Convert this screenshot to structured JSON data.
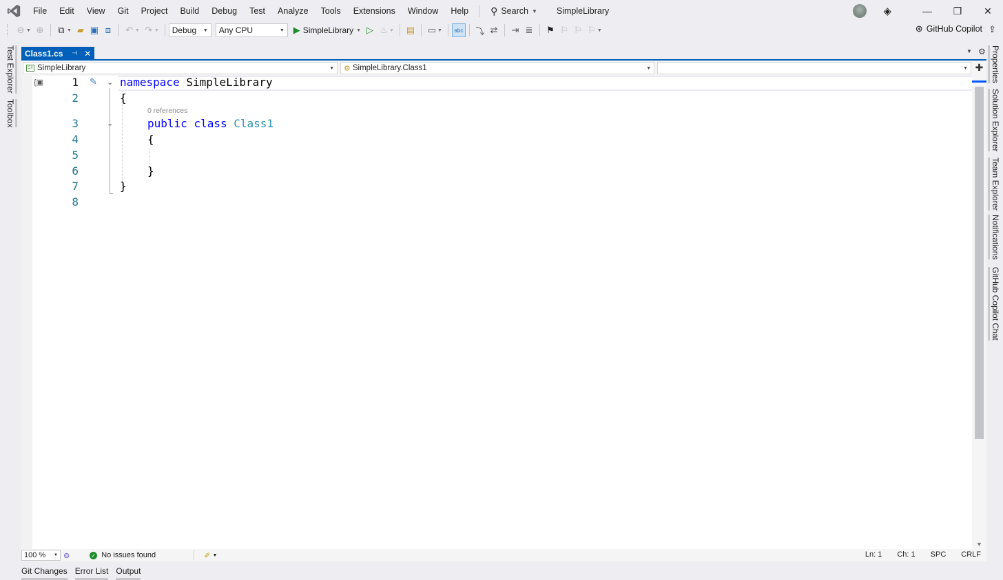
{
  "menubar": {
    "items": [
      "File",
      "Edit",
      "View",
      "Git",
      "Project",
      "Build",
      "Debug",
      "Test",
      "Analyze",
      "Tools",
      "Extensions",
      "Window",
      "Help"
    ],
    "search_label": "Search",
    "solution_name": "SimpleLibrary"
  },
  "toolbar": {
    "configuration": "Debug",
    "platform": "Any CPU",
    "startup_project": "SimpleLibrary",
    "copilot_label": "GitHub Copilot"
  },
  "left_tabs": [
    "Test Explorer",
    "Toolbox"
  ],
  "right_tabs": [
    "Properties",
    "Solution Explorer",
    "Team Explorer",
    "Notifications",
    "GitHub Copilot Chat"
  ],
  "document": {
    "tab_title": "Class1.cs"
  },
  "navbar": {
    "project": "SimpleLibrary",
    "type": "SimpleLibrary.Class1",
    "member": ""
  },
  "editor": {
    "line_numbers": [
      "1",
      "2",
      "3",
      "4",
      "5",
      "6",
      "7",
      "8"
    ],
    "codelens": "0 references",
    "lines": {
      "l1_kw": "namespace",
      "l1_name": "SimpleLibrary",
      "l2": "{",
      "l3_kw1": "public",
      "l3_kw2": "class",
      "l3_type": "Class1",
      "l4": "{",
      "l6": "}",
      "l7": "}"
    }
  },
  "status": {
    "zoom": "100 %",
    "issues": "No issues found",
    "line": "Ln: 1",
    "col": "Ch: 1",
    "whitespace": "SPC",
    "line_ending": "CRLF"
  },
  "bottom_tabs": [
    "Git Changes",
    "Error List",
    "Output"
  ],
  "colors": {
    "accent": "#005fb8",
    "keyword": "#0000ff",
    "type": "#2b91af",
    "line_number": "#237893"
  }
}
